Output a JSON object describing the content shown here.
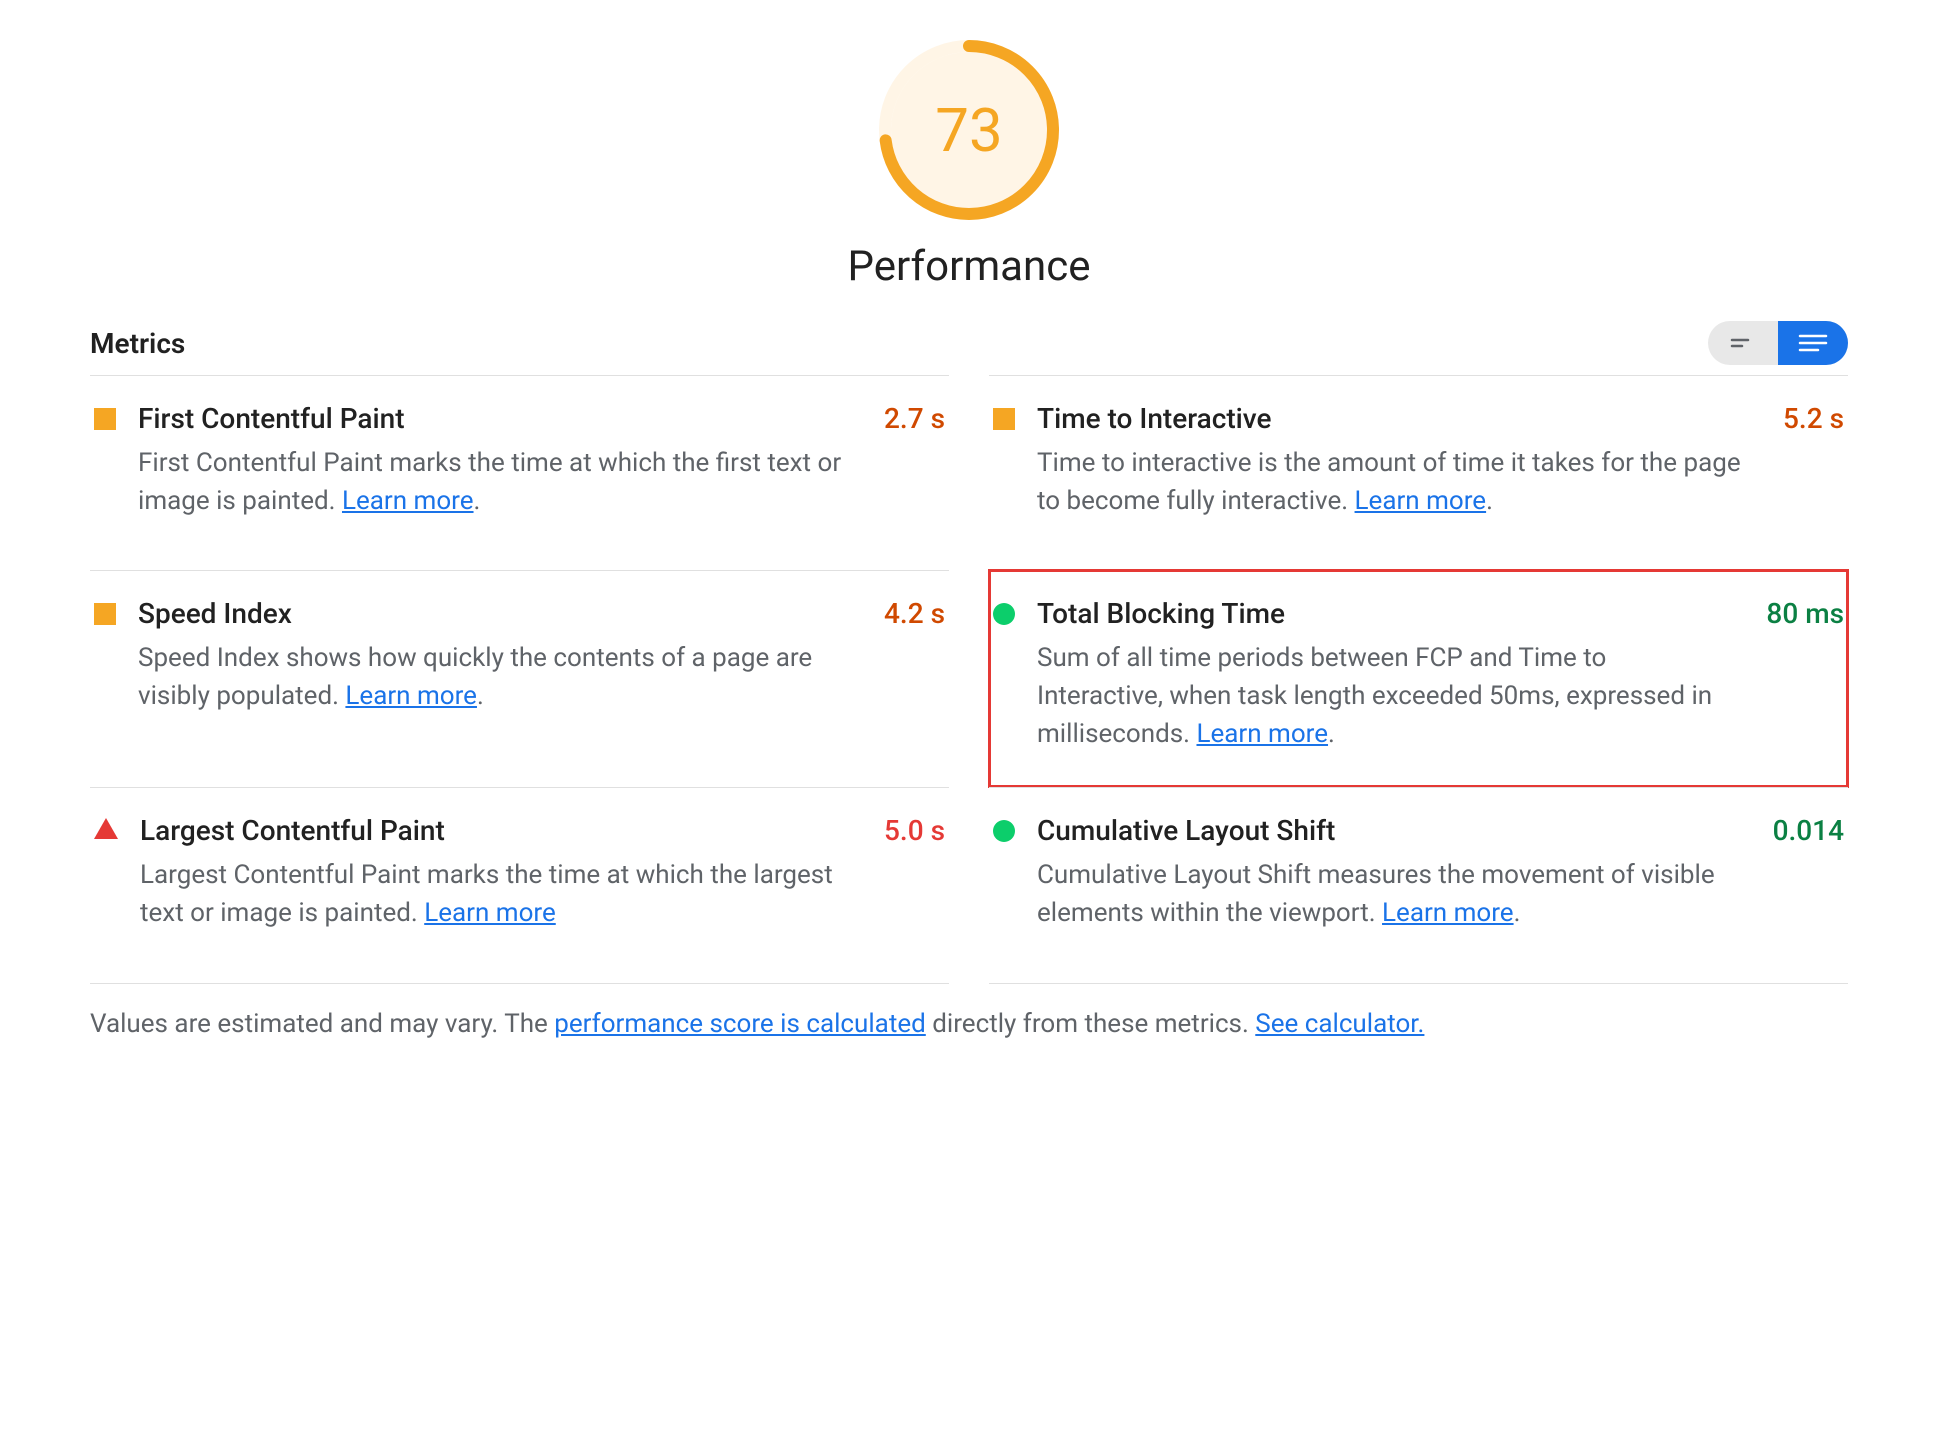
{
  "gauge": {
    "score": "73",
    "percent": 73
  },
  "category": {
    "title": "Performance"
  },
  "section": {
    "heading": "Metrics"
  },
  "toggle": {
    "collapsed_label": "collapsed",
    "expanded_label": "expanded"
  },
  "metrics": {
    "fcp": {
      "title": "First Contentful Paint",
      "desc": "First Contentful Paint marks the time at which the first text or image is painted. ",
      "learn": "Learn more",
      "value": "2.7 s"
    },
    "tti": {
      "title": "Time to Interactive",
      "desc": "Time to interactive is the amount of time it takes for the page to become fully interactive. ",
      "learn": "Learn more",
      "value": "5.2 s"
    },
    "si": {
      "title": "Speed Index",
      "desc": "Speed Index shows how quickly the contents of a page are visibly populated. ",
      "learn": "Learn more",
      "value": "4.2 s"
    },
    "tbt": {
      "title": "Total Blocking Time",
      "desc": "Sum of all time periods between FCP and Time to Interactive, when task length exceeded 50ms, expressed in milliseconds. ",
      "learn": "Learn more",
      "value": "80 ms"
    },
    "lcp": {
      "title": "Largest Contentful Paint",
      "desc": "Largest Contentful Paint marks the time at which the largest text or image is painted. ",
      "learn": "Learn more",
      "value": "5.0 s"
    },
    "cls": {
      "title": "Cumulative Layout Shift",
      "desc": "Cumulative Layout Shift measures the movement of visible elements within the viewport. ",
      "learn": "Learn more",
      "value": "0.014"
    }
  },
  "footer": {
    "pre": "Values are estimated and may vary. The ",
    "link1": "performance score is calculated",
    "mid": " directly from these metrics. ",
    "link2": "See calculator."
  }
}
